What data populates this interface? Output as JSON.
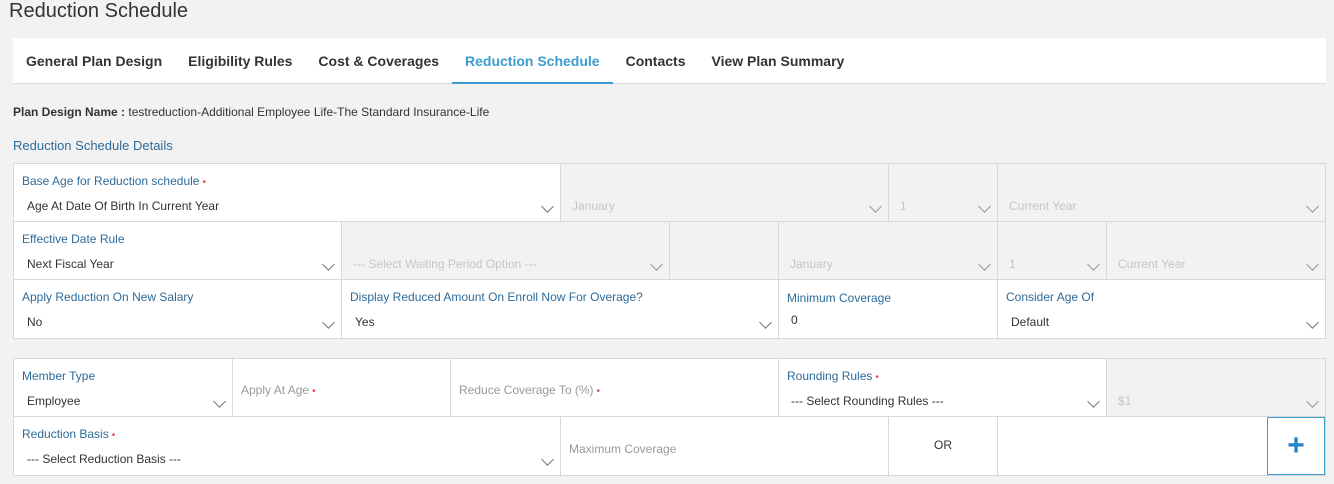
{
  "page": {
    "title": "Reduction Schedule"
  },
  "tabs": [
    {
      "label": "General Plan Design"
    },
    {
      "label": "Eligibility Rules"
    },
    {
      "label": "Cost & Coverages"
    },
    {
      "label": "Reduction Schedule"
    },
    {
      "label": "Contacts"
    },
    {
      "label": "View Plan Summary"
    }
  ],
  "plan": {
    "label": "Plan Design Name :",
    "value": "testreduction-Additional Employee Life-The Standard Insurance-Life"
  },
  "section": {
    "title": "Reduction Schedule Details"
  },
  "details": {
    "base_age_label": "Base Age for Reduction schedule",
    "base_age_value": "Age At Date Of Birth In Current Year",
    "base_month": "January",
    "base_day": "1",
    "base_year": "Current Year",
    "effective_label": "Effective Date Rule",
    "effective_value": "Next Fiscal Year",
    "waiting_period": "--- Select Waiting Period Option ---",
    "eff_month": "January",
    "eff_day": "1",
    "eff_year": "Current Year",
    "apply_label": "Apply Reduction On New Salary",
    "apply_value": "No",
    "display_label": "Display Reduced Amount On Enroll Now For Overage?",
    "display_value": "Yes",
    "min_label": "Minimum Coverage",
    "min_value": "0",
    "consider_label": "Consider Age Of",
    "consider_value": "Default"
  },
  "schedule": {
    "member_label": "Member Type",
    "member_value": "Employee",
    "apply_age_label": "Apply At Age",
    "reduce_label": "Reduce Coverage To (%)",
    "rounding_label": "Rounding Rules",
    "rounding_value": "--- Select Rounding Rules ---",
    "rounding_amount": "$1",
    "basis_label": "Reduction Basis",
    "basis_value": "--- Select Reduction Basis ---",
    "max_label": "Maximum Coverage",
    "or_label": "OR",
    "add_icon": "+"
  },
  "colors": {
    "accent": "#3c9ccf",
    "label": "#2e6b98",
    "required": "#e04b4b"
  }
}
